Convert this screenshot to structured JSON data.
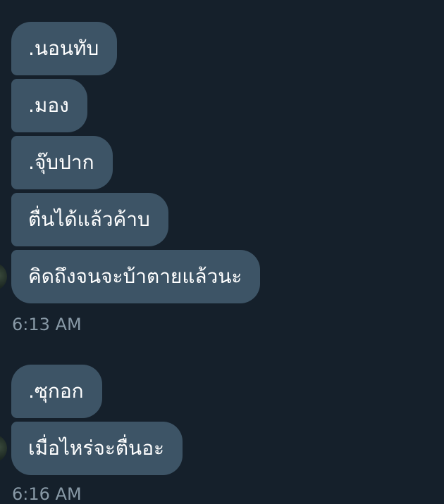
{
  "conversation": {
    "groups": [
      {
        "messages": [
          ".นอนทับ",
          ".มอง",
          ".จุ๊บปาก",
          "ตื่นได้แล้วค้าบ",
          "คิดถึงจนจะบ้าตายแล้วนะ"
        ],
        "timestamp": "6:13 AM"
      },
      {
        "messages": [
          ".ซุกอก",
          "เมื่อไหร่จะตื่นอะ"
        ],
        "timestamp": "6:16 AM"
      }
    ]
  },
  "colors": {
    "background": "#15202b",
    "bubble": "#3d5466",
    "text": "#ffffff",
    "timestamp": "#8899a6"
  },
  "icons": {
    "sender_avatar": "avatar-image"
  }
}
